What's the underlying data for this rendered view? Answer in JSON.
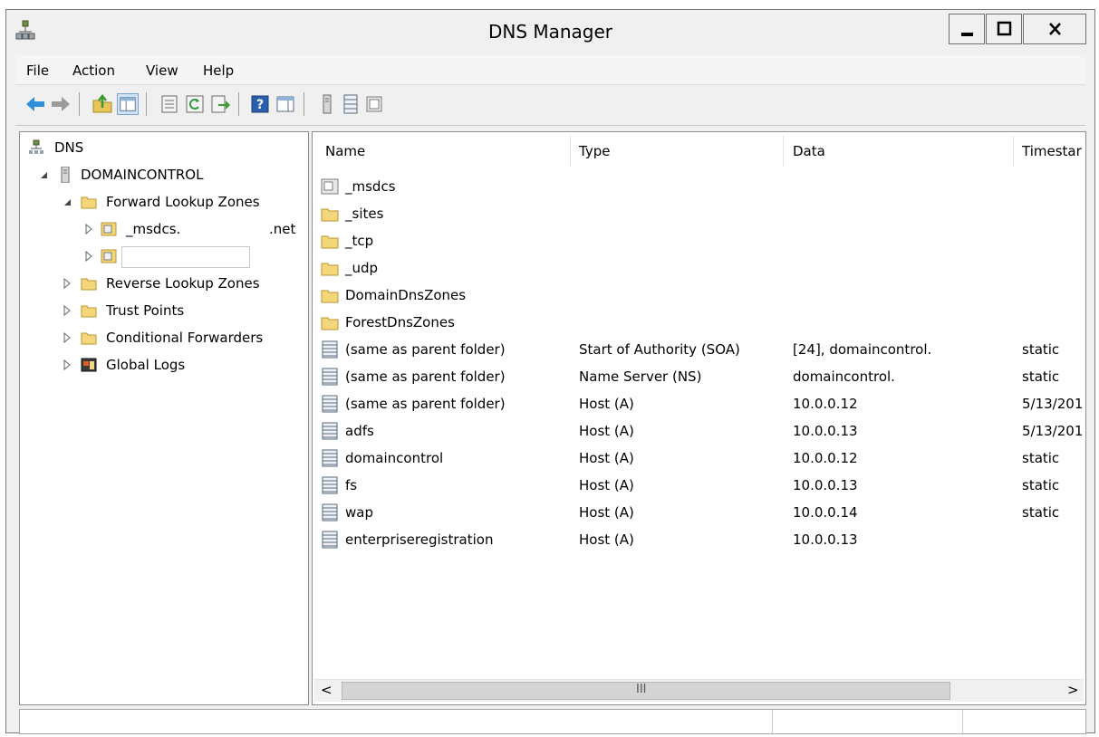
{
  "window": {
    "title": "DNS Manager"
  },
  "window_controls": {
    "minimize": "minimize",
    "maximize": "maximize",
    "close": "close"
  },
  "menu": {
    "items": [
      "File",
      "Action",
      "View",
      "Help"
    ]
  },
  "toolbar": {
    "icons": [
      "back-arrow-icon",
      "forward-arrow-icon",
      "up-folder-icon",
      "show-hide-tree-icon",
      "properties-icon",
      "refresh-icon",
      "export-list-icon",
      "help-icon",
      "show-hide-action-pane-icon",
      "server-icon",
      "records-list-icon",
      "zone-icon"
    ]
  },
  "tree": {
    "root": "DNS",
    "server": "DOMAINCONTROL",
    "forward_zones": "Forward Lookup Zones",
    "msdcs_zone_prefix": "_msdcs.",
    "msdcs_zone_suffix": ".net",
    "reverse_zones": "Reverse Lookup Zones",
    "trust_points": "Trust Points",
    "conditional_forwarders": "Conditional Forwarders",
    "global_logs": "Global Logs"
  },
  "columns": {
    "name": "Name",
    "type": "Type",
    "data": "Data",
    "timestamp": "Timestar"
  },
  "rows": [
    {
      "icon": "zone",
      "name": "_msdcs",
      "type": "",
      "data": "",
      "timestamp": ""
    },
    {
      "icon": "folder",
      "name": "_sites",
      "type": "",
      "data": "",
      "timestamp": ""
    },
    {
      "icon": "folder",
      "name": "_tcp",
      "type": "",
      "data": "",
      "timestamp": ""
    },
    {
      "icon": "folder",
      "name": "_udp",
      "type": "",
      "data": "",
      "timestamp": ""
    },
    {
      "icon": "folder",
      "name": "DomainDnsZones",
      "type": "",
      "data": "",
      "timestamp": ""
    },
    {
      "icon": "folder",
      "name": "ForestDnsZones",
      "type": "",
      "data": "",
      "timestamp": ""
    },
    {
      "icon": "record",
      "name": "(same as parent folder)",
      "type": "Start of Authority (SOA)",
      "data": "[24], domaincontrol.",
      "timestamp": "static"
    },
    {
      "icon": "record",
      "name": "(same as parent folder)",
      "type": "Name Server (NS)",
      "data": "domaincontrol.",
      "timestamp": "static"
    },
    {
      "icon": "record",
      "name": "(same as parent folder)",
      "type": "Host (A)",
      "data": "10.0.0.12",
      "timestamp": "5/13/201"
    },
    {
      "icon": "record",
      "name": "adfs",
      "type": "Host (A)",
      "data": "10.0.0.13",
      "timestamp": "5/13/201"
    },
    {
      "icon": "record",
      "name": "domaincontrol",
      "type": "Host (A)",
      "data": "10.0.0.12",
      "timestamp": "static"
    },
    {
      "icon": "record",
      "name": "fs",
      "type": "Host (A)",
      "data": "10.0.0.13",
      "timestamp": "static"
    },
    {
      "icon": "record",
      "name": "wap",
      "type": "Host (A)",
      "data": "10.0.0.14",
      "timestamp": "static"
    },
    {
      "icon": "record",
      "name": "enterpriseregistration",
      "type": "Host (A)",
      "data": "10.0.0.13",
      "timestamp": ""
    }
  ],
  "scrollbar": {
    "thumb_grip": "III",
    "left_arrow": "<",
    "right_arrow": ">"
  },
  "colors": {
    "folder": "#f3d77a",
    "accent_arrow": "#2f8fd8",
    "selection": "#cfe3f7"
  }
}
